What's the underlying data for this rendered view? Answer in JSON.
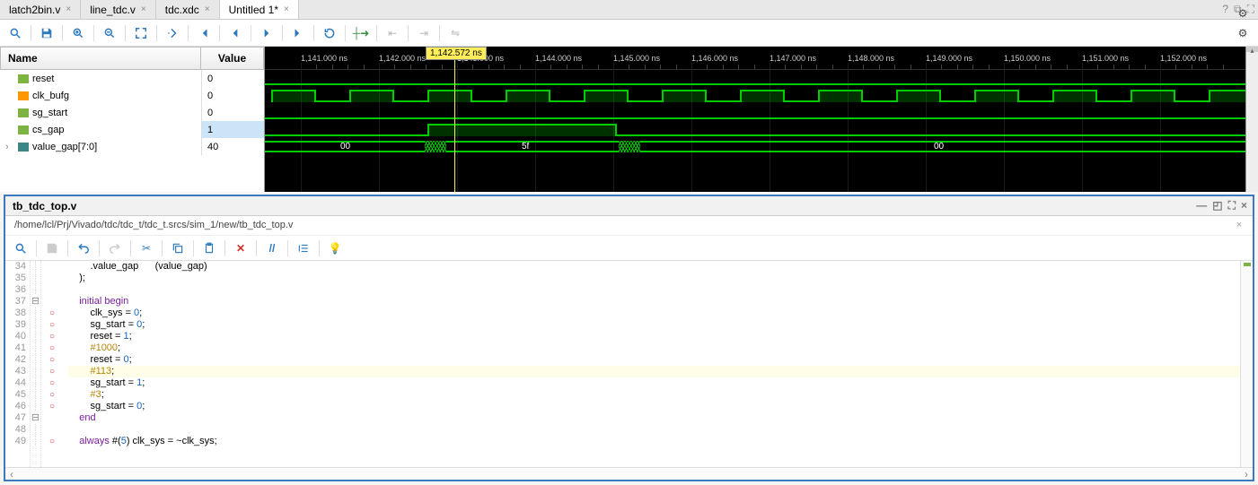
{
  "tabs": [
    {
      "label": "latch2bin.v"
    },
    {
      "label": "line_tdc.v"
    },
    {
      "label": "tdc.xdc"
    },
    {
      "label": "Untitled 1*",
      "active": true
    }
  ],
  "toolbar_icons": [
    "search",
    "save",
    "zoom-in",
    "zoom-out",
    "zoom-fit",
    "step",
    "go-first",
    "prev",
    "next",
    "go-last",
    "restart",
    "add-marker",
    "del-marker",
    "swap",
    "floating"
  ],
  "waveform": {
    "marker_time": "1,142.572 ns",
    "marker_x_px": 181,
    "ticks": [
      "1,141.000 ns",
      "1,142.000 ns",
      "1,143.000 ns",
      "1,144.000 ns",
      "1,145.000 ns",
      "1,146.000 ns",
      "1,147.000 ns",
      "1,148.000 ns",
      "1,149.000 ns",
      "1,150.000 ns",
      "1,151.000 ns",
      "1,152.000 ns"
    ],
    "signals_hdr_name": "Name",
    "signals_hdr_val": "Value",
    "signals": [
      {
        "name": "reset",
        "value": "0",
        "icon": "wire"
      },
      {
        "name": "clk_bufg",
        "value": "0",
        "icon": "reg"
      },
      {
        "name": "sg_start",
        "value": "0",
        "icon": "wire"
      },
      {
        "name": "cs_gap",
        "value": "1",
        "icon": "wire",
        "selected": true
      },
      {
        "name": "value_gap[7:0]",
        "value": "40",
        "icon": "bus",
        "expandable": true
      }
    ],
    "bus_values": [
      "00",
      "5f",
      "00"
    ]
  },
  "editor": {
    "title": "tb_tdc_top.v",
    "path": "/home/lcl/Prj/Vivado/tdc/tdc_t/tdc_t.srcs/sim_1/new/tb_tdc_top.v",
    "toolbar": [
      "search",
      "save",
      "undo",
      "redo",
      "cut",
      "copy",
      "paste",
      "delete",
      "comment",
      "indent",
      "lightbulb"
    ],
    "lines": [
      {
        "n": 34,
        "bp": false,
        "txt": "        .value_gap      (value_gap)"
      },
      {
        "n": 35,
        "bp": false,
        "txt": "    );"
      },
      {
        "n": 36,
        "bp": false,
        "txt": ""
      },
      {
        "n": 37,
        "bp": false,
        "fold": "⊟",
        "txt": "    initial begin",
        "kw": "initial begin"
      },
      {
        "n": 38,
        "bp": true,
        "txt": "        clk_sys = 0;"
      },
      {
        "n": 39,
        "bp": true,
        "txt": "        sg_start = 0;"
      },
      {
        "n": 40,
        "bp": true,
        "txt": "        reset = 1;"
      },
      {
        "n": 41,
        "bp": true,
        "txt": "        #1000;"
      },
      {
        "n": 42,
        "bp": true,
        "txt": "        reset = 0;"
      },
      {
        "n": 43,
        "bp": true,
        "txt": "        #113;",
        "hl": true
      },
      {
        "n": 44,
        "bp": true,
        "txt": "        sg_start = 1;"
      },
      {
        "n": 45,
        "bp": true,
        "txt": "        #3;"
      },
      {
        "n": 46,
        "bp": true,
        "txt": "        sg_start = 0;"
      },
      {
        "n": 47,
        "bp": false,
        "fold": "⊟",
        "txt": "    end",
        "kw": "end"
      },
      {
        "n": 48,
        "bp": false,
        "txt": ""
      },
      {
        "n": 49,
        "bp": true,
        "txt": "    always #(5) clk_sys = ~clk_sys;",
        "kw": "always"
      }
    ]
  }
}
